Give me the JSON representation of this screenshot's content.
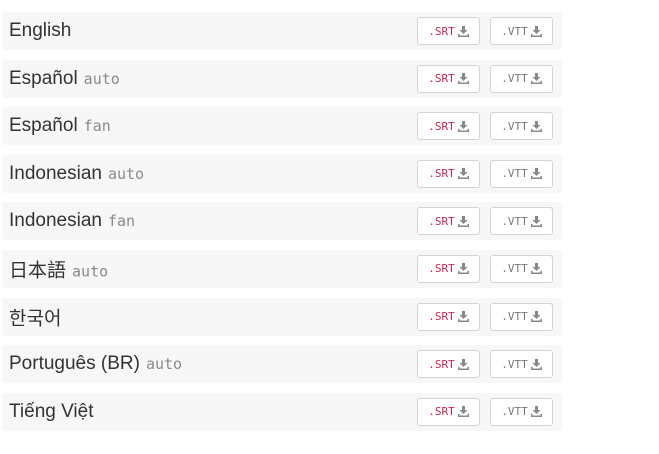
{
  "subtitles": [
    {
      "language": "English",
      "tag": ""
    },
    {
      "language": "Español",
      "tag": "auto"
    },
    {
      "language": "Español",
      "tag": "fan"
    },
    {
      "language": "Indonesian",
      "tag": "auto"
    },
    {
      "language": "Indonesian",
      "tag": "fan"
    },
    {
      "language": "日本語",
      "tag": "auto"
    },
    {
      "language": "한국어",
      "tag": ""
    },
    {
      "language": "Português (BR)",
      "tag": "auto"
    },
    {
      "language": "Tiếng Việt",
      "tag": ""
    }
  ],
  "buttons": {
    "srt_label": ".SRT",
    "vtt_label": ".VTT",
    "icon": "download-icon"
  },
  "colors": {
    "row_background": "#f7f7f7",
    "srt_text": "#c7254e",
    "vtt_text": "#777777",
    "tag_text": "#8a8a8a",
    "icon": "#888888"
  }
}
